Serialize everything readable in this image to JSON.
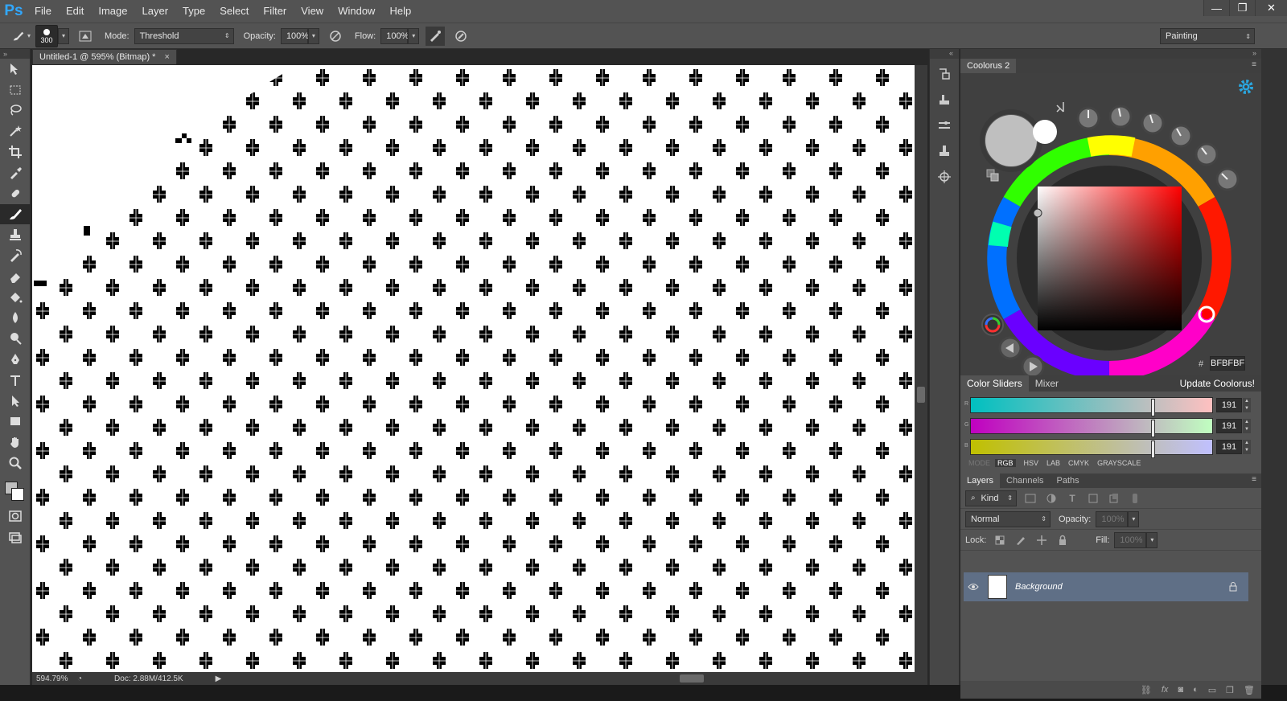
{
  "app": {
    "logo": "Ps"
  },
  "menu": [
    "File",
    "Edit",
    "Image",
    "Layer",
    "Type",
    "Select",
    "Filter",
    "View",
    "Window",
    "Help"
  ],
  "window_controls": {
    "minimize": "—",
    "restore": "❐",
    "close": "✕"
  },
  "options": {
    "brush_size": "300",
    "mode_label": "Mode:",
    "mode_value": "Threshold",
    "opacity_label": "Opacity:",
    "opacity_value": "100%",
    "flow_label": "Flow:",
    "flow_value": "100%",
    "workspace": "Painting"
  },
  "document": {
    "tab_title": "Untitled-1 @ 595% (Bitmap) *",
    "tab_close": "×",
    "zoom": "594.79%",
    "doc_info": "Doc: 2.88M/412.5K"
  },
  "coolorus": {
    "title": "Coolorus 2",
    "hex_symbol": "#",
    "hex_value": "BFBFBF",
    "hue_color": "#ff0000",
    "current_color": "#bfbfbf"
  },
  "color_sliders": {
    "tabs": [
      "Color Sliders",
      "Mixer"
    ],
    "update_link": "Update Coolorus!",
    "channels": [
      {
        "label": "R",
        "value": "191"
      },
      {
        "label": "G",
        "value": "191"
      },
      {
        "label": "B",
        "value": "191"
      }
    ],
    "mode_label": "MODE",
    "modes": [
      "RGB",
      "HSV",
      "LAB",
      "CMYK",
      "GRAYSCALE"
    ]
  },
  "layers": {
    "tabs": [
      "Layers",
      "Channels",
      "Paths"
    ],
    "kind_filter": "Kind",
    "blend_mode": "Normal",
    "opacity_label": "Opacity:",
    "opacity_value": "100%",
    "lock_label": "Lock:",
    "fill_label": "Fill:",
    "fill_value": "100%",
    "items": [
      {
        "name": "Background",
        "visible": true,
        "locked": true
      }
    ],
    "footer_icons": [
      "link-icon",
      "fx-icon",
      "mask-icon",
      "adjustment-icon",
      "folder-icon",
      "new-layer-icon",
      "trash-icon"
    ]
  }
}
